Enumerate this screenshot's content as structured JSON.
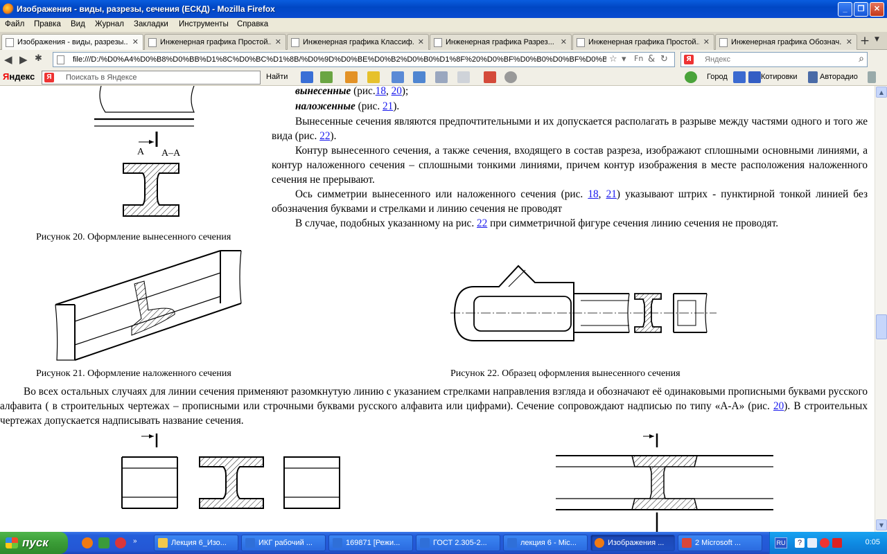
{
  "window": {
    "title": "Изображения - виды, разрезы, сечения (ЕСКД) - Mozilla Firefox",
    "controls": [
      "_",
      "❐",
      "✕"
    ]
  },
  "menu": [
    "Файл",
    "Правка",
    "Вид",
    "Журнал",
    "Закладки",
    "Инструменты",
    "Справка"
  ],
  "tabs": [
    {
      "label": "Изображения - виды, разрезы...",
      "active": true
    },
    {
      "label": "Инженерная графика Простой...",
      "active": false
    },
    {
      "label": "Инженерная графика Классиф...",
      "active": false
    },
    {
      "label": "Инженерная графика Разрез...",
      "active": false
    },
    {
      "label": "Инженерная графика Простой...",
      "active": false
    },
    {
      "label": "Инженерная графика Обознач...",
      "active": false
    }
  ],
  "nav": {
    "url": "file:///D:/%D0%A4%D0%B8%D0%BB%D1%8C%D0%BC%D1%8B/%D0%9D%D0%BE%D0%B2%D0%B0%D1%8F%20%D0%BF%D0%B0%D0%BF%D0%BA%D0%B0...",
    "search_placeholder": "Яндекс"
  },
  "yandex": {
    "logo_red": "Я",
    "logo_rest": "ндекс",
    "search_placeholder": "Поискать в Яндексе",
    "find": "Найти",
    "right": [
      "Город",
      "Котировки",
      "Авторадио"
    ]
  },
  "doc": {
    "line1_bold": "вынесенные",
    "line1_pre": " (рис.",
    "line1_l1": "18",
    "line1_sep": ", ",
    "line1_l2": "20",
    "line1_post": ");",
    "line2_bold": "наложенные",
    "line2_pre": " (рис. ",
    "line2_l1": "21",
    "line2_post": ").",
    "p1_a": "Вынесенные сечения являются предпочтительными и их допускается располагать в разрыве между частями одного и того же вида (рис. ",
    "p1_link": "22",
    "p1_b": ").",
    "p2": "Контур вынесенного сечения, а также сечения, входящего в состав  разреза, изображают сплошными основными линиями, а контур наложенного сечения – сплошными тонкими линиями, причем контур изображения в месте расположения наложенного сечения не прерывают.",
    "p3_a": "Ось симметрии вынесенного или наложенного сечения (рис. ",
    "p3_l1": "18",
    "p3_sep": ", ",
    "p3_l2": "21",
    "p3_b": ") указывают штрих - пунктирной тонкой линией без обозначения буквами и стрелками и линию сечения не проводят",
    "p4_a": "В случае, подобных указанному на рис. ",
    "p4_link": "22",
    "p4_b": " при симметричной фигуре сечения линию сечения не проводят.",
    "cap20": "Рисунок 20. Оформление вынесенного сечения",
    "cap21": "Рисунок 21. Оформление наложенного сечения",
    "cap22": "Рисунок 22. Образец оформления вынесенного сечения",
    "fig20_label_a": "А",
    "fig20_label_aa": "А–А",
    "p5_a": "Во всех остальных случаях для линии сечения применяют разомкнутую линию с указанием стрелками направления взгляда и обозначают её одинаковыми прописными буквами русского алфавита ( в строительных чертежах – прописными или строчными буквами русского алфавита или цифрами). Сечение сопровождают надписью по типу «А-А» (рис. ",
    "p5_link": "20",
    "p5_b": "). В строительных чертежах допускается надписывать название сечения."
  },
  "taskbar": {
    "start": "пуск",
    "buttons": [
      {
        "label": "Лекция 6_Изо...",
        "color": "#f2c94c"
      },
      {
        "label": "ИКГ рабочий ...",
        "color": "#2f6fd8"
      },
      {
        "label": "169871 [Режи...",
        "color": "#2f6fd8"
      },
      {
        "label": "ГОСТ 2.305-2...",
        "color": "#2f6fd8"
      },
      {
        "label": "лекция 6 - Mic...",
        "color": "#2f6fd8"
      },
      {
        "label": "Изображения ...",
        "color": "#f07a12"
      },
      {
        "label": "2 Microsoft ...",
        "color": "#d9463a"
      }
    ],
    "lang": "RU",
    "clock": "0:05"
  }
}
